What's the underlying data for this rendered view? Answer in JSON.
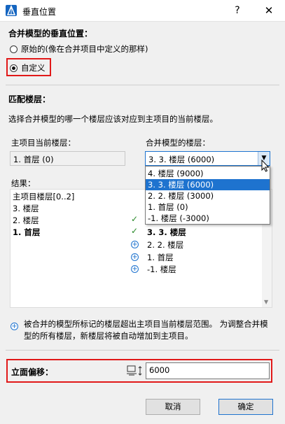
{
  "window": {
    "title": "垂直位置",
    "help_glyph": "?",
    "close_glyph": "✕"
  },
  "merge_section": {
    "title": "合并模型的垂直位置：",
    "option_original": "原始的(像在合并项目中定义的那样)",
    "option_custom": "自定义",
    "selected": "custom"
  },
  "match_section": {
    "title": "匹配楼层：",
    "description": "选择合并模型的哪一个楼层应该对应到主项目的当前楼层。",
    "host_label": "主项目当前楼层：",
    "host_value": "1. 首层 (0)",
    "merged_label": "合并模型的楼层：",
    "merged_selected": "3. 3. 楼层 (6000)",
    "merged_options": [
      "4. 楼层 (9000)",
      "3. 3. 楼层 (6000)",
      "2. 2. 楼层 (3000)",
      "1. 首层 (0)",
      "-1. 楼层 (-3000)"
    ]
  },
  "results": {
    "label": "结果：",
    "host_header": "主项目楼层[0..2]",
    "host_rows": [
      "3. 楼层",
      "2. 楼层",
      "1. 首层"
    ],
    "merged_rows": [
      {
        "status": "check",
        "text": "3. 3. 楼层",
        "bold": true
      },
      {
        "status": "plus",
        "text": "2. 2. 楼层"
      },
      {
        "status": "plus",
        "text": "1. 首层"
      },
      {
        "status": "plus",
        "text": "-1. 楼层"
      }
    ]
  },
  "note": {
    "text": "被合并的模型所标记的楼层超出主项目当前楼层范围。 为调整合并模型的所有楼层，新楼层将被自动增加到主项目。"
  },
  "offset": {
    "label": "立面偏移：",
    "value": "6000"
  },
  "buttons": {
    "cancel": "取消",
    "ok": "确定"
  },
  "colors": {
    "accent": "#1e73cf",
    "highlight_border": "#e11919",
    "check_green": "#2a8a2a"
  },
  "icons": [
    "app-icon",
    "help-icon",
    "close-icon",
    "chevron-down-icon",
    "check-icon",
    "plus-circle-icon",
    "elevation-offset-icon"
  ]
}
